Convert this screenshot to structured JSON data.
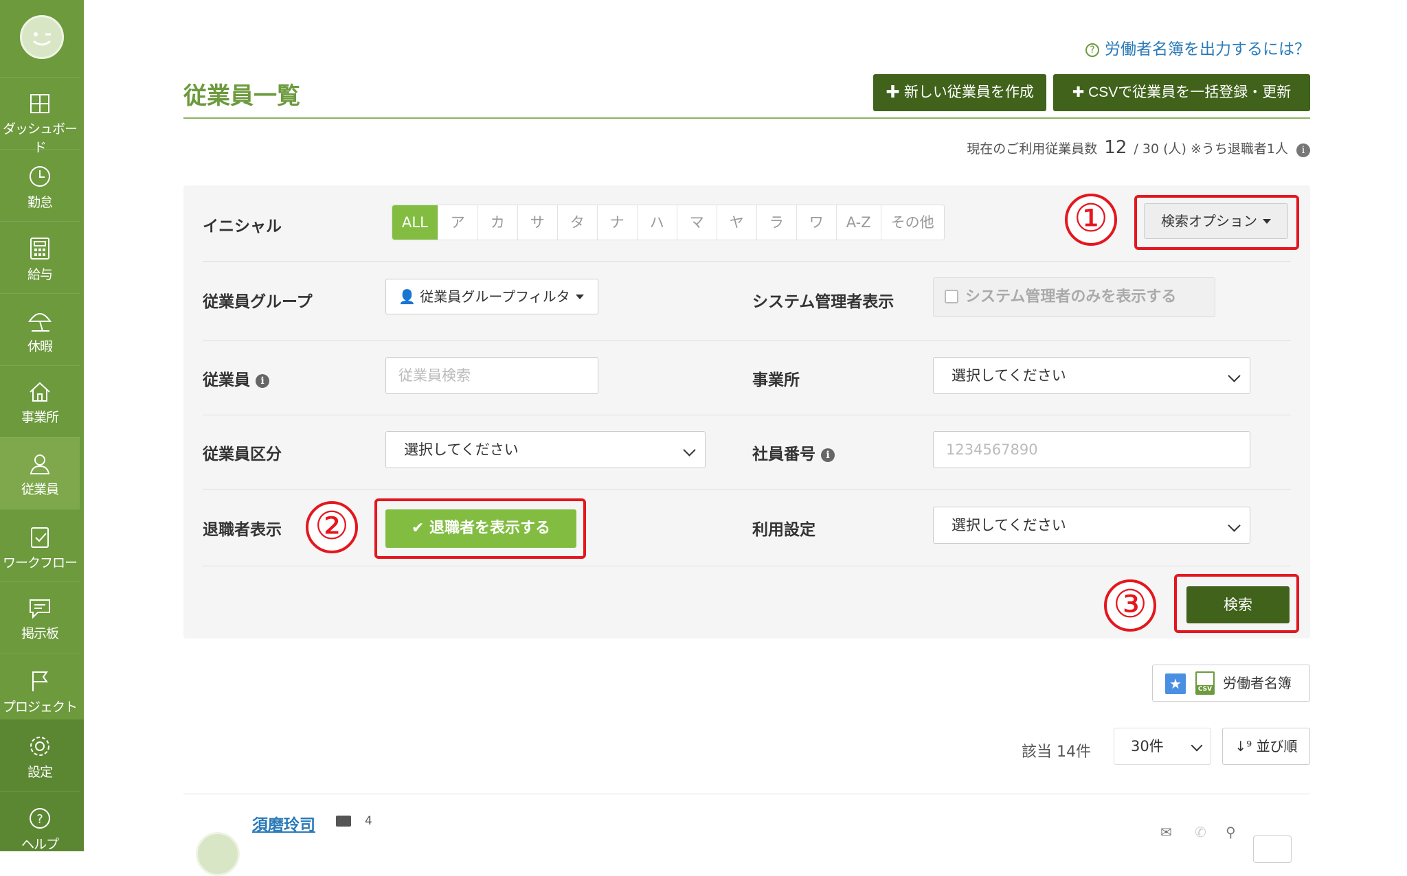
{
  "sidebar": {
    "items": [
      {
        "label": "ダッシュボード",
        "icon": "dashboard-icon"
      },
      {
        "label": "勤怠",
        "icon": "clock-icon"
      },
      {
        "label": "給与",
        "icon": "calculator-icon"
      },
      {
        "label": "休暇",
        "icon": "umbrella-icon"
      },
      {
        "label": "事業所",
        "icon": "home-icon"
      },
      {
        "label": "従業員",
        "icon": "user-icon"
      },
      {
        "label": "ワークフロー",
        "icon": "clipboard-check-icon"
      },
      {
        "label": "掲示板",
        "icon": "chat-icon"
      },
      {
        "label": "プロジェクト",
        "icon": "flag-icon"
      },
      {
        "label": "設定",
        "icon": "gear-icon"
      },
      {
        "label": "ヘルプ",
        "icon": "help-circle-icon"
      }
    ]
  },
  "header": {
    "help_link": "労働者名簿を出力するには？",
    "title": "従業員一覧",
    "new_employee_button": "新しい従業員を作成",
    "csv_import_button": "CSVで従業員を一括登録・更新"
  },
  "usage": {
    "prefix": "現在のご利用従業員数",
    "current": "12",
    "rest": "/ 30 (人) ※うち退職者1人"
  },
  "filters": {
    "initial_label": "イニシャル",
    "initials": [
      "ALL",
      "ア",
      "カ",
      "サ",
      "タ",
      "ナ",
      "ハ",
      "マ",
      "ヤ",
      "ラ",
      "ワ",
      "A-Z",
      "その他"
    ],
    "search_options_button": "検索オプション",
    "group_label": "従業員グループ",
    "group_filter_button": "従業員グループフィルタ",
    "sysadmin_label": "システム管理者表示",
    "sysadmin_checkbox": "システム管理者のみを表示する",
    "employee_label": "従業員",
    "employee_placeholder": "従業員検索",
    "office_label": "事業所",
    "office_select": "選択してください",
    "category_label": "従業員区分",
    "category_select": "選択してください",
    "staff_no_label": "社員番号",
    "staff_no_placeholder": "1234567890",
    "retired_label": "退職者表示",
    "retired_button": "退職者を表示する",
    "usage_label": "利用設定",
    "usage_select": "選択してください",
    "search_button": "検索"
  },
  "annotations": {
    "one": "①",
    "two": "②",
    "three": "③"
  },
  "results": {
    "roster_button": "労働者名簿",
    "csv_badge": "CSV",
    "count": "該当 14件",
    "per_page": "30件",
    "sort_button": "並び順"
  },
  "employee": {
    "name": "須磨玲司",
    "number": "4"
  },
  "colors": {
    "sidebar": "#6c9a3d",
    "accent": "#82bd42",
    "dark_button": "#40621b",
    "annotation": "#e4171e"
  }
}
